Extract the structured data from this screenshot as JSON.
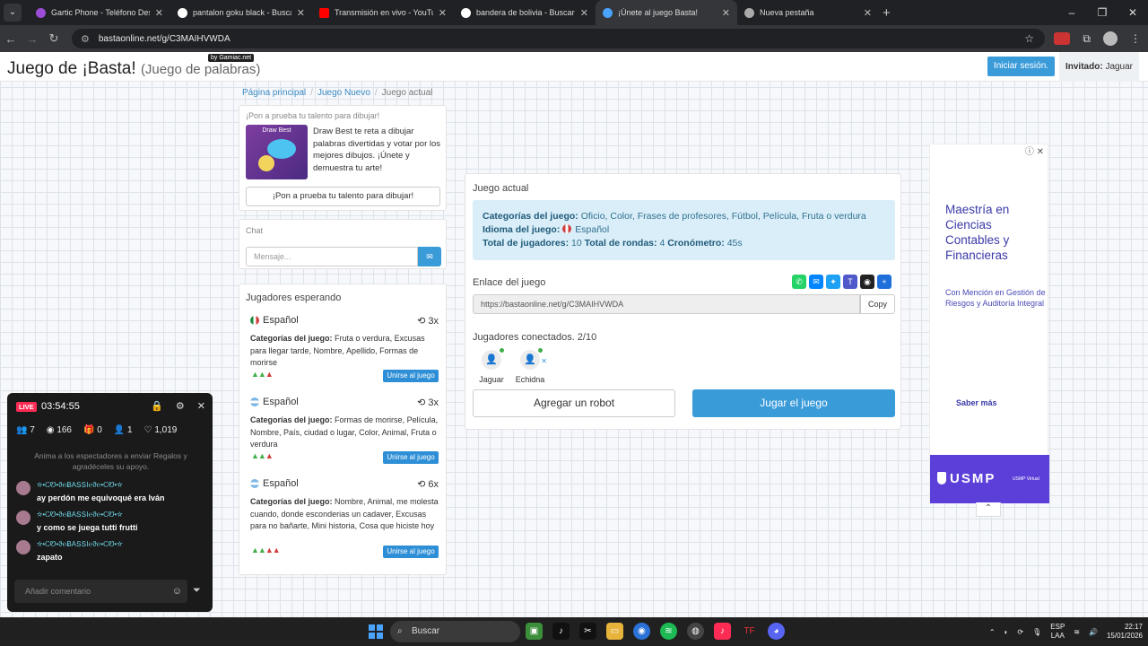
{
  "browser": {
    "tabs": [
      {
        "title": "Gartic Phone - Teléfono Descon",
        "color": "#9b4dd8"
      },
      {
        "title": "pantalon goku black - Buscar c",
        "color": "#ffffff"
      },
      {
        "title": "Transmisión en vivo - YouTube",
        "color": "#ff0000"
      },
      {
        "title": "bandera de bolivia - Buscar con",
        "color": "#ffffff"
      },
      {
        "title": "¡Únete al juego Basta!",
        "color": "#4aa3ff",
        "active": true
      },
      {
        "title": "Nueva pestaña",
        "color": "#aaaaaa"
      }
    ],
    "url": "bastaonline.net/g/C3MAIHVWDA"
  },
  "header": {
    "title": "Juego de ¡Basta!",
    "subtitle": "(Juego de palabras)",
    "badge": "by Gamiac.net",
    "login": "Iniciar sesión.",
    "guest_label": "Invitado:",
    "guest_name": "Jaguar"
  },
  "breadcrumb": [
    "Página principal",
    "Juego Nuevo",
    "Juego actual"
  ],
  "promo": {
    "title": "¡Pon a prueba tu talento para dibujar!",
    "image_caption": "Draw Best",
    "text": "Draw Best te reta a dibujar palabras divertidas y votar por los mejores dibujos. ¡Únete y demuestra tu arte!",
    "button": "¡Pon a prueba tu talento para dibujar!"
  },
  "chat": {
    "title": "Chat",
    "placeholder": "Mensaje..."
  },
  "waiting": {
    "title": "Jugadores esperando",
    "categories_label": "Categorías del juego:",
    "join_label": "Unirse al juego",
    "rooms": [
      {
        "lang": "Español",
        "flag": "mx",
        "rounds": "3x",
        "categories": "Fruta o verdura, Excusas para llegar tarde, Nombre, Apellido, Formas de morirse",
        "players_green": 2,
        "players_red": 1
      },
      {
        "lang": "Español",
        "flag": "ar",
        "rounds": "3x",
        "categories": "Formas de morirse, Película, Nombre, País, ciudad o lugar, Color, Animal, Fruta o verdura",
        "players_green": 2,
        "players_red": 1
      },
      {
        "lang": "Español",
        "flag": "ar",
        "rounds": "6x",
        "categories": "Nombre, Animal, me molesta cuando, donde esconderias un cadaver, Excusas para no bañarte, Mini historia, Cosa que hiciste hoy",
        "players_green": 2,
        "players_red": 2
      }
    ]
  },
  "game": {
    "title": "Juego actual",
    "categories_label": "Categorías del juego:",
    "categories": "Oficio, Color, Frases de profesores, Fútbol, Película, Fruta o verdura",
    "language_label": "Idioma del juego:",
    "language": "Español",
    "players_label": "Total de jugadores:",
    "players": "10",
    "rounds_label": "Total de rondas:",
    "rounds": "4",
    "timer_label": "Cronómetro:",
    "timer": "45s",
    "link_label": "Enlace del juego",
    "link": "https://bastaonline.net/g/C3MAIHVWDA",
    "copy": "Copy",
    "connected_label": "Jugadores conectados. 2/10",
    "connected": [
      "Jaguar",
      "Echidna"
    ],
    "add_robot": "Agregar un robot",
    "play": "Jugar el juego",
    "share_icons": [
      "whatsapp-icon",
      "messenger-icon",
      "twitter-icon",
      "teams-icon",
      "snapchat-icon",
      "plus-icon"
    ]
  },
  "ad": {
    "headline": "Maestría en Ciencias Contables y Financieras",
    "sub": "Con Mención en Gestión de Riesgos y Auditoría Integral",
    "cta": "Saber más",
    "brand": "USMP",
    "brand_sub": "USMP Virtual"
  },
  "live": {
    "tag": "LIVE",
    "time": "03:54:55",
    "stats": {
      "guests": "7",
      "views": "166",
      "gifts": "0",
      "followers": "1",
      "likes": "1,019"
    },
    "hint": "Anima a los espectadores a enviar Regalos y agradéceles su apoyo.",
    "comments": [
      {
        "user": "☆•ᏟᏬ•ϑ℮ɃAՏՏI℮ϑ℮•ᏟᏬ•☆",
        "text": "ay perdón me equivoqué era Iván"
      },
      {
        "user": "☆•ᏟᏬ•ϑ℮ɃAՏՏI℮ϑ℮•ᏟᏬ•☆",
        "text": "y como se juega tutti frutti"
      },
      {
        "user": "☆•ᏟᏬ•ϑ℮ɃAՏՏI℮ϑ℮•ᏟᏬ•☆",
        "text": "zapato"
      }
    ],
    "add_comment": "Añadir comentario"
  },
  "taskbar": {
    "search": "Buscar",
    "lang1": "ESP",
    "lang2": "LAA",
    "time": "22:17",
    "date": "15/01/2026"
  }
}
